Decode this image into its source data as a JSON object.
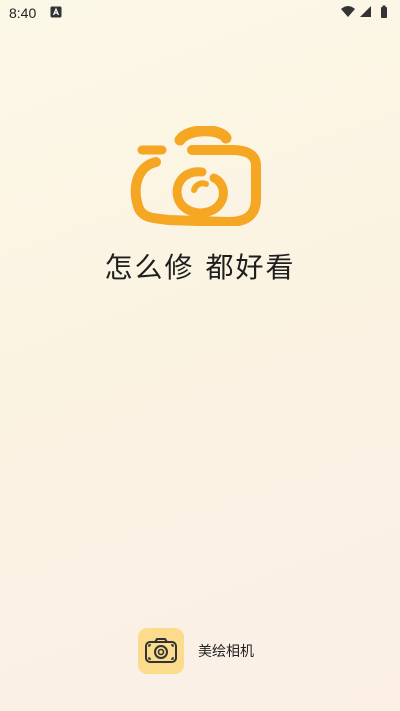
{
  "status_bar": {
    "time": "8:40",
    "notification_icon": "a-box-icon",
    "wifi_icon": "wifi-icon",
    "signal_icon": "signal-icon",
    "battery_icon": "battery-icon"
  },
  "splash": {
    "logo_icon": "camera-brush-logo-icon",
    "logo_color": "#f5a623",
    "slogan": "怎么修 都好看"
  },
  "footer": {
    "app_icon": "camera-icon",
    "app_icon_bg": "#fbdb8c",
    "app_name": "美绘相机"
  }
}
